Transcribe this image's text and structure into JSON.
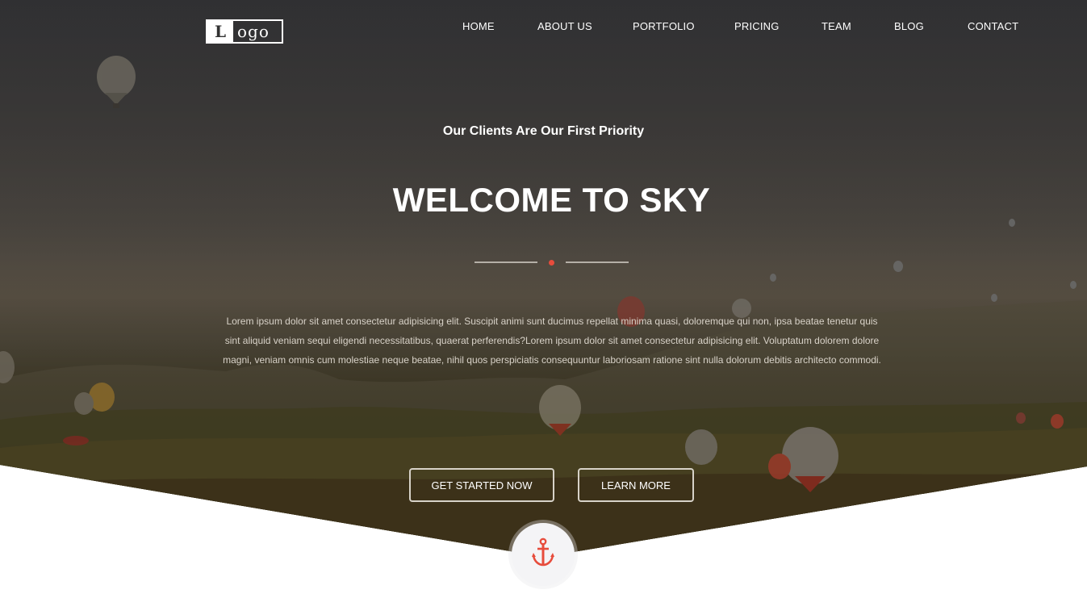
{
  "logo": {
    "mark": "L",
    "text": "ogo"
  },
  "nav": {
    "items": [
      {
        "label": "HOME"
      },
      {
        "label": "ABOUT US"
      },
      {
        "label": "PORTFOLIO"
      },
      {
        "label": "PRICING"
      },
      {
        "label": "TEAM"
      },
      {
        "label": "BLOG"
      },
      {
        "label": "CONTACT"
      }
    ]
  },
  "hero": {
    "subtitle": "Our Clients Are Our First Priority",
    "title": "WELCOME TO SKY",
    "body": "Lorem ipsum dolor sit amet consectetur adipisicing elit. Suscipit animi sunt ducimus repellat minima quasi, doloremque qui non, ipsa beatae tenetur quis sint aliquid veniam sequi eligendi necessitatibus, quaerat perferendis?Lorem ipsum dolor sit amet consectetur adipisicing elit. Voluptatum dolorem dolore magni, veniam omnis cum molestiae neque beatae, nihil quos perspiciatis consequuntur laboriosam ratione sint nulla dolorum debitis architecto commodi.",
    "primary_button": "GET STARTED NOW",
    "secondary_button": "LEARN MORE"
  },
  "icons": {
    "scroll_down": "anchor-icon",
    "divider_dot": "dot"
  },
  "colors": {
    "accent": "#e74c3c",
    "text": "#ffffff"
  }
}
